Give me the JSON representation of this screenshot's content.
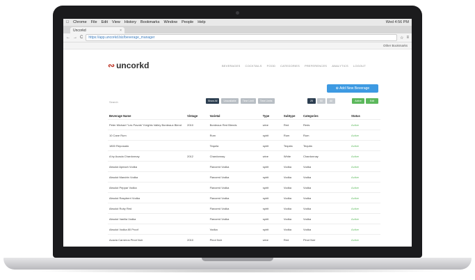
{
  "menubar": {
    "apple": "",
    "items": [
      "Chrome",
      "File",
      "Edit",
      "View",
      "History",
      "Bookmarks",
      "Window",
      "People",
      "Help"
    ],
    "clock": "Wed 4:56 PM"
  },
  "tab": {
    "title": "Uncorkd"
  },
  "address": {
    "url": "https://app.uncorkd.biz/beverage_manager"
  },
  "bookmarks": {
    "label": "Other Bookmarks"
  },
  "app": {
    "brand": "uncorkd",
    "nav": [
      "BEVERAGES",
      "COCKTAILS",
      "FOOD",
      "CATEGORIES",
      "PREFERENCES",
      "ANALYTICS",
      "LOGOUT"
    ],
    "add_button": "⊕ Add New Beverage",
    "search_placeholder": "Search",
    "filters": [
      "Show All",
      "Unavailable",
      "Time Limit",
      "Time Limits"
    ],
    "page_sizes": [
      "25",
      "50",
      "All"
    ],
    "status_filters": [
      "Active",
      "Edit"
    ]
  },
  "table": {
    "headers": [
      "Beverage Name",
      "Vintage",
      "Varietal",
      "Type",
      "Subtype",
      "Categories",
      "Status"
    ],
    "rows": [
      [
        "Peter Michael \"Les Pavots\" Knights Valley Bordeaux Blend",
        "2010",
        "Bordeaux Red Blends",
        "wine",
        "Red",
        "Reds",
        "Active"
      ],
      [
        "10 Cane Rum",
        "",
        "Rum",
        "spirit",
        "Rum",
        "Rum",
        "Active"
      ],
      [
        "1800 Reposado",
        "",
        "Tequila",
        "spirit",
        "Tequila",
        "Tequila",
        "Active"
      ],
      [
        "A by Acacia Chardonnay",
        "2012",
        "Chardonnay",
        "wine",
        "White",
        "Chardonnay",
        "Active"
      ],
      [
        "Absolut Apeach Vodka",
        "",
        "Flavored Vodka",
        "spirit",
        "Vodka",
        "Vodka",
        "Active"
      ],
      [
        "Absolut Mandrin Vodka",
        "",
        "Flavored Vodka",
        "spirit",
        "Vodka",
        "Vodka",
        "Active"
      ],
      [
        "Absolut Peppar Vodka",
        "",
        "Flavored Vodka",
        "spirit",
        "Vodka",
        "Vodka",
        "Active"
      ],
      [
        "Absolut Raspberri Vodka",
        "",
        "Flavored Vodka",
        "spirit",
        "Vodka",
        "Vodka",
        "Active"
      ],
      [
        "Absolut Ruby Red",
        "",
        "Flavored Vodka",
        "spirit",
        "Vodka",
        "Vodka",
        "Active"
      ],
      [
        "Absolut Vanilia Vodka",
        "",
        "Flavored Vodka",
        "spirit",
        "Vodka",
        "Vodka",
        "Active"
      ],
      [
        "Absolut Vodka 80 Proof",
        "",
        "Vodka",
        "spirit",
        "Vodka",
        "Vodka",
        "Active"
      ],
      [
        "Acacia Carneros Pinot Noir",
        "2010",
        "Pinot Noir",
        "wine",
        "Red",
        "Pinot Noir",
        "Active"
      ]
    ]
  },
  "colors": {
    "accent": "#3d9ae2",
    "brand": "#c0392b",
    "active": "#5cb85c",
    "dark_button": "#2c3e50"
  }
}
